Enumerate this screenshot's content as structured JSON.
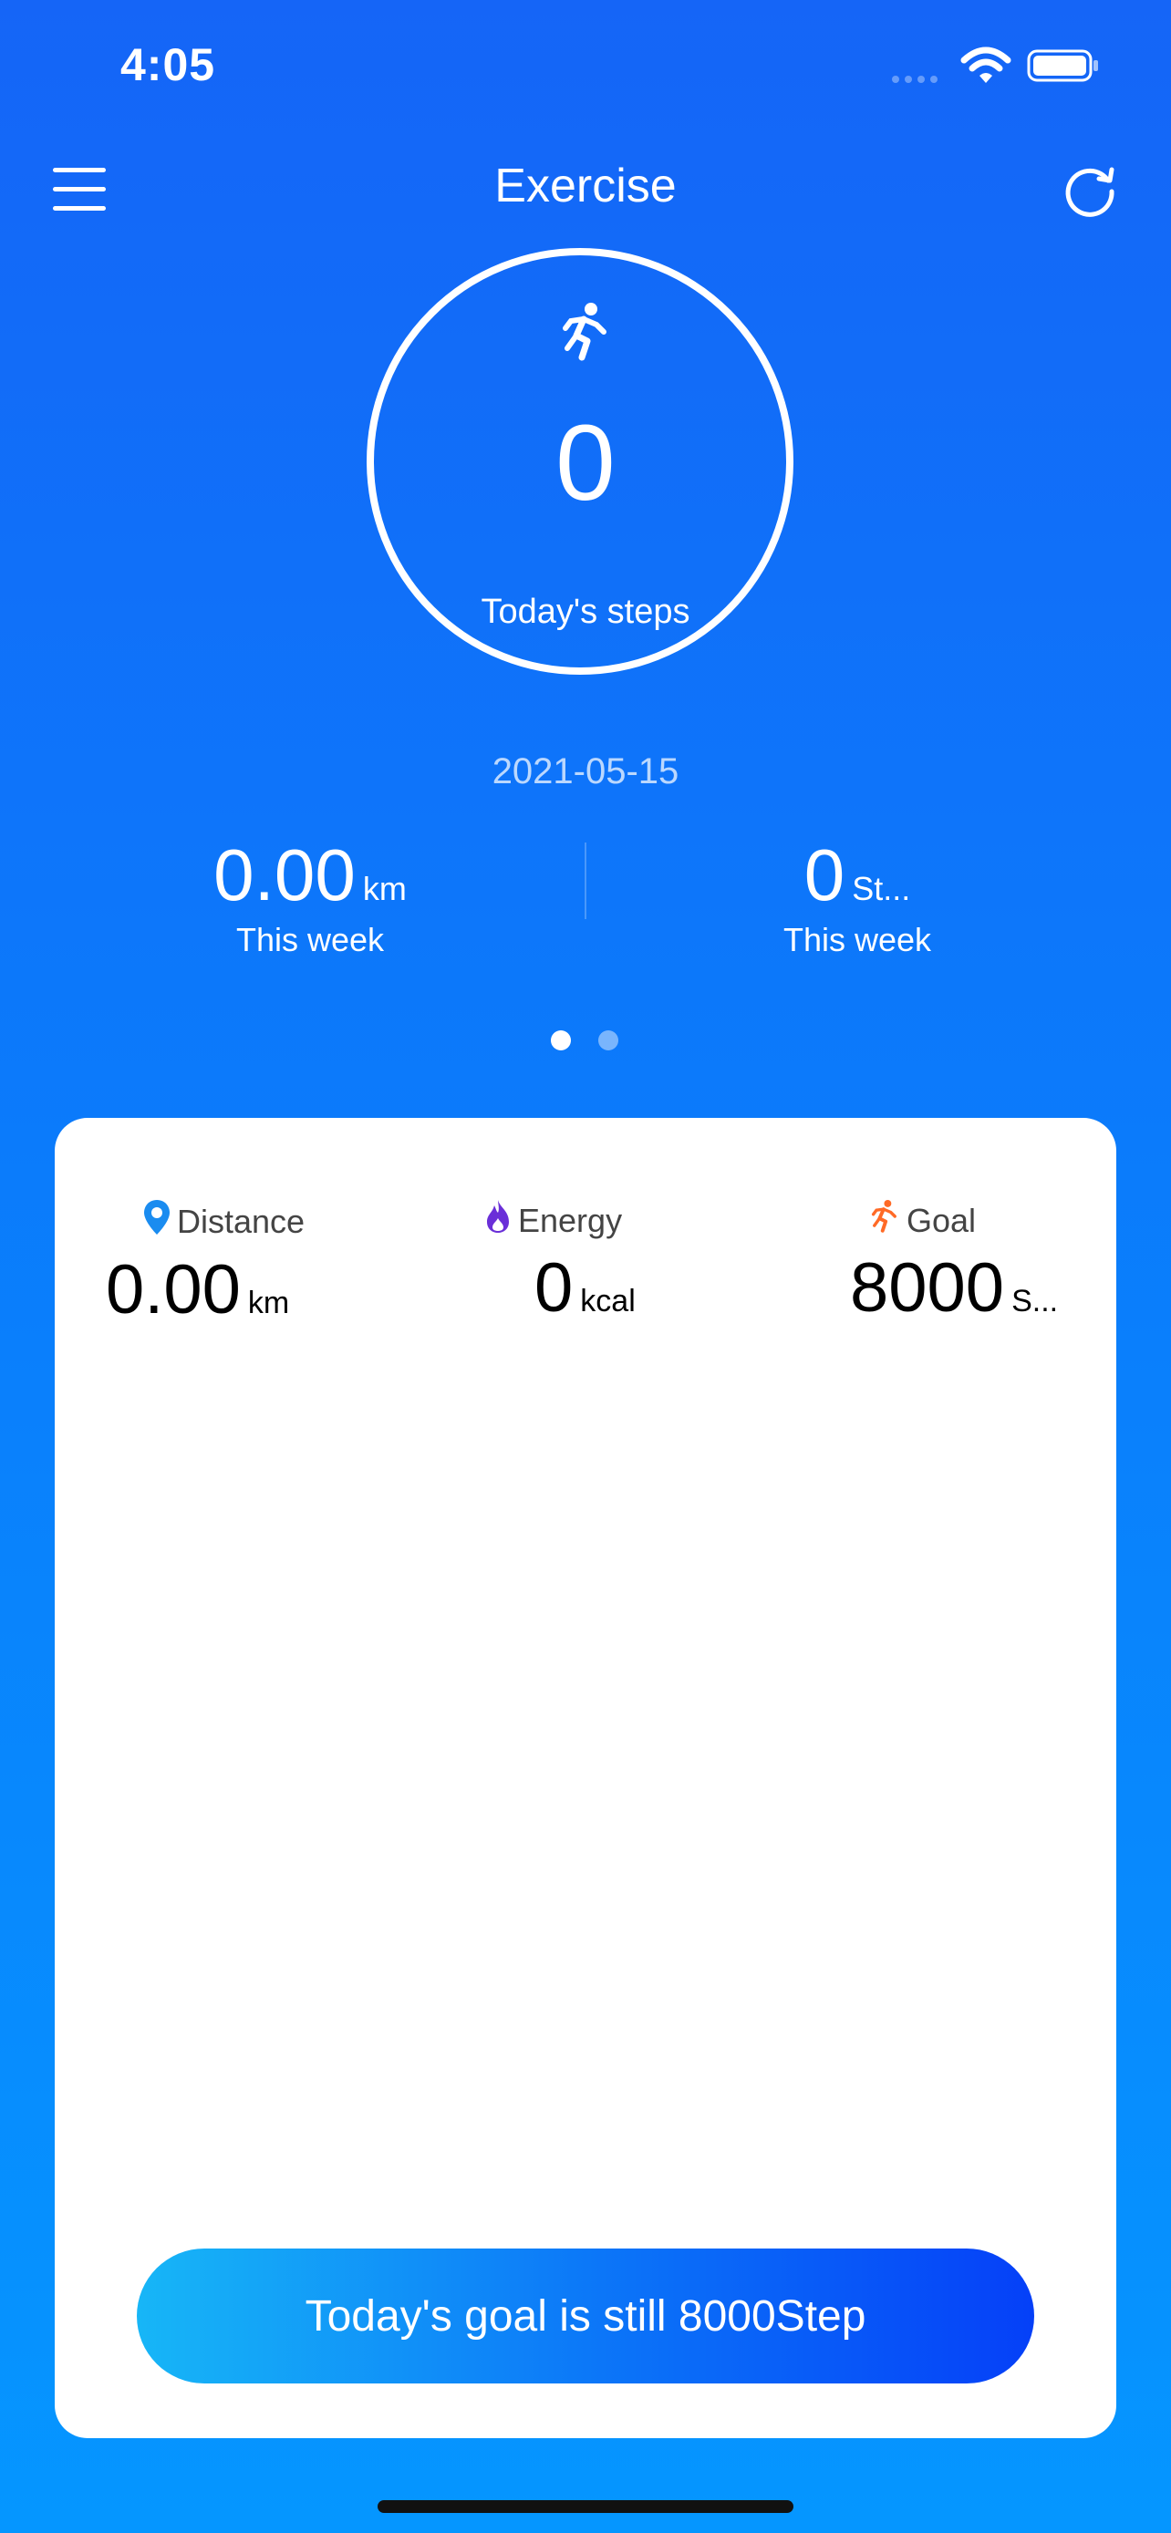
{
  "status_bar": {
    "time": "4:05"
  },
  "header": {
    "title": "Exercise",
    "menu_icon": "hamburger-menu-icon",
    "refresh_icon": "refresh-icon"
  },
  "today": {
    "steps": "0",
    "label": "Today's steps",
    "icon": "runner-icon"
  },
  "date": "2021-05-15",
  "week_summary": {
    "distance": {
      "value": "0.00",
      "unit": "km",
      "label": "This week"
    },
    "steps": {
      "value": "0",
      "unit": "St...",
      "label": "This week"
    }
  },
  "pager": {
    "active_index": 0,
    "count": 2
  },
  "metrics": {
    "distance": {
      "label": "Distance",
      "value": "0.00",
      "unit": "km",
      "icon": "location-pin-icon",
      "color": "#1a8cf0"
    },
    "energy": {
      "label": "Energy",
      "value": "0",
      "unit": "kcal",
      "icon": "flame-icon",
      "color": "#6a2fd8"
    },
    "goal": {
      "label": "Goal",
      "value": "8000",
      "unit": "S...",
      "icon": "runner-icon",
      "color": "#ff6a26"
    }
  },
  "goal_button": {
    "label": "Today's goal is still 8000Step"
  },
  "colors": {
    "background_top": "#1565f7",
    "background_bottom": "#0596ff",
    "card": "#ffffff"
  }
}
